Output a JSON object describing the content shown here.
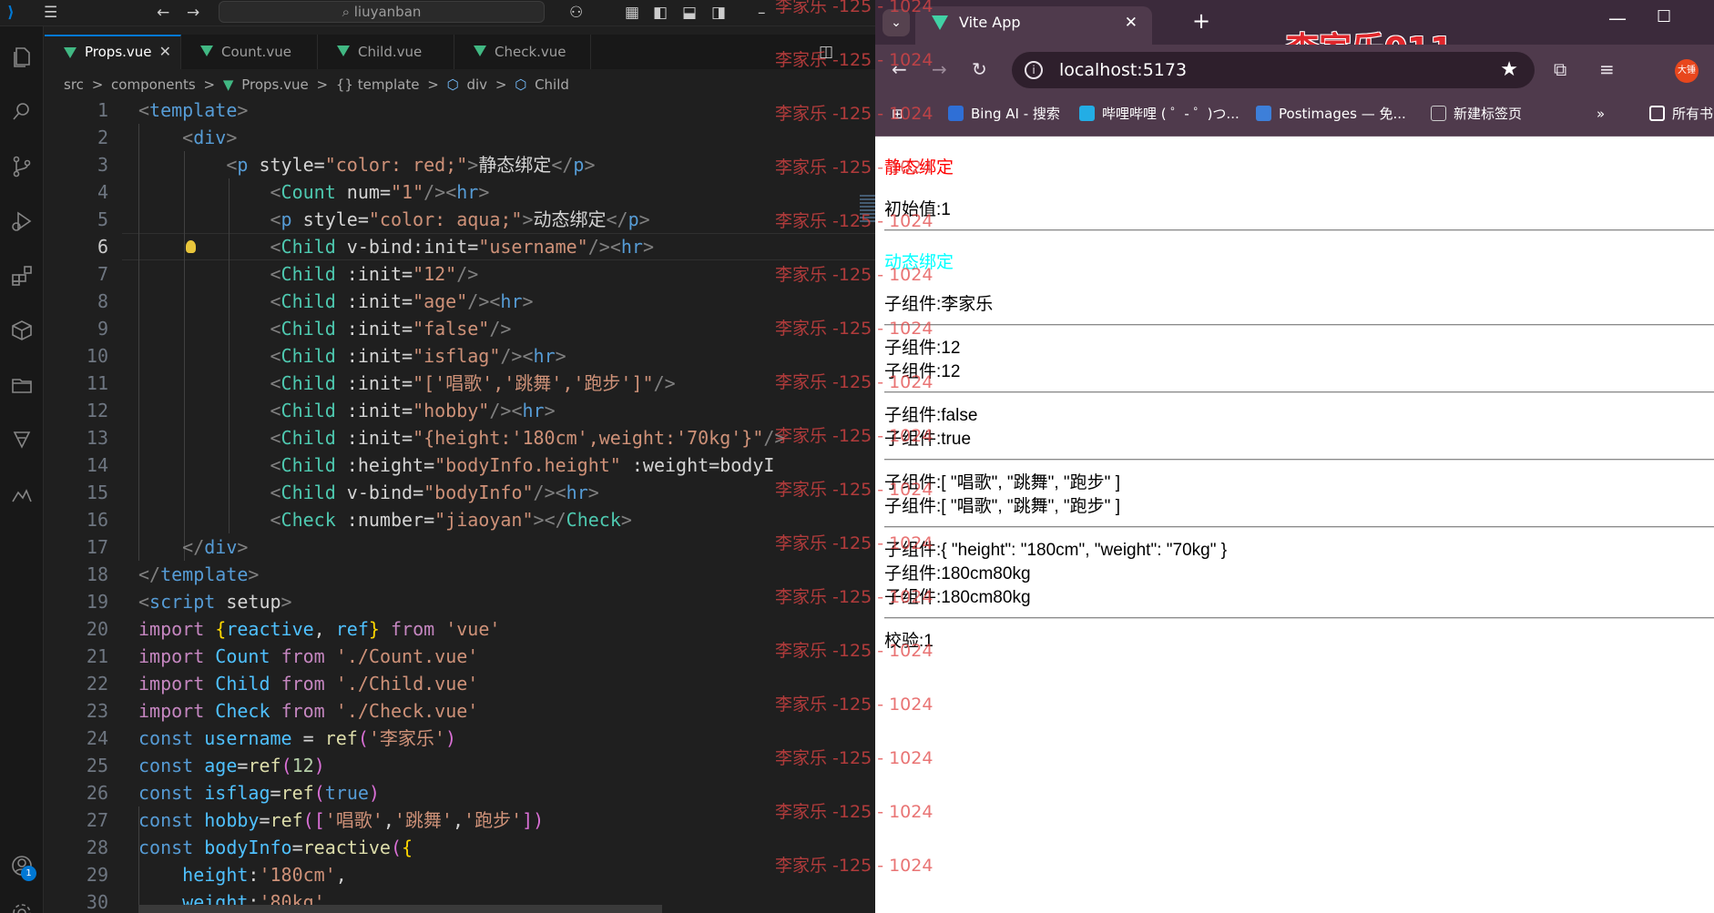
{
  "vscode": {
    "title_search": "liuyanban",
    "tabs": [
      {
        "label": "Props.vue",
        "active": true
      },
      {
        "label": "Count.vue",
        "active": false
      },
      {
        "label": "Child.vue",
        "active": false
      },
      {
        "label": "Check.vue",
        "active": false
      }
    ],
    "breadcrumb": [
      "src",
      ">",
      "components",
      ">",
      "Props.vue",
      ">",
      "{} template",
      ">",
      "div",
      ">",
      "Child"
    ],
    "badge_count": "1",
    "current_line": 6,
    "line_numbers": [
      "1",
      "2",
      "3",
      "4",
      "5",
      "6",
      "7",
      "8",
      "9",
      "10",
      "11",
      "12",
      "13",
      "14",
      "15",
      "16",
      "17",
      "18",
      "19",
      "20",
      "21",
      "22",
      "23",
      "24",
      "25",
      "26",
      "27",
      "28",
      "29",
      "30"
    ],
    "code_lines": [
      "<template>",
      "    <div>",
      "        <p style=\"color: red;\">静态绑定</p>",
      "            <Count num=\"1\"/><hr>",
      "            <p style=\"color: aqua;\">动态绑定</p>",
      "            <Child v-bind:init=\"username\"/><hr>",
      "            <Child :init=\"12\"/>",
      "            <Child :init=\"age\"/><hr>",
      "            <Child :init=\"false\"/>",
      "            <Child :init=\"isflag\"/><hr>",
      "            <Child :init=\"['唱歌','跳舞','跑步']\"/>",
      "            <Child :init=\"hobby\"/><hr>",
      "            <Child :init=\"{height:'180cm',weight:'70kg'}\"/>",
      "            <Child :height=\"bodyInfo.height\" :weight=\"bodyI",
      "            <Child v-bind=\"bodyInfo\"/><hr>",
      "            <Check :number=\"jiaoyan\"></Check>",
      "    </div>",
      "</template>",
      "<script setup>",
      "import {reactive, ref} from 'vue'",
      "import Count from './Count.vue'",
      "import Child from './Child.vue'",
      "import Check from './Check.vue'",
      "const username = ref('李家乐')",
      "const age=ref(12)",
      "const isflag=ref(true)",
      "const hobby=ref(['唱歌','跳舞','跑步'])",
      "const bodyInfo=reactive({",
      "    height:'180cm',",
      "    weight:'80kg'"
    ]
  },
  "browser": {
    "tab_title": "Vite App",
    "url": "localhost:5173",
    "overlay_text": "李家乐011",
    "avatar_text": "大锤",
    "bookmarks": [
      "Bing AI - 搜索",
      "哔哩哔哩 ( ゜- ゜)つ...",
      "Postimages — 免...",
      "新建标签页",
      "所有书"
    ],
    "content": {
      "static_title": "静态绑定",
      "initial_value": "初始值:1",
      "dynamic_title": "动态绑定",
      "lines": [
        "子组件:李家乐",
        "子组件:12",
        "子组件:12",
        "子组件:false",
        "子组件:true",
        "子组件:[ \"唱歌\", \"跳舞\", \"跑步\" ]",
        "子组件:[ \"唱歌\", \"跳舞\", \"跑步\" ]",
        "子组件:{ \"height\": \"180cm\", \"weight\": \"70kg\" }",
        "子组件:180cm80kg",
        "子组件:180cm80kg",
        "校验:1"
      ]
    }
  },
  "watermark": {
    "text": "李家乐 -125 - 1024",
    "color": "#e24646"
  },
  "colors": {
    "vue_green": "#41b883",
    "accent_blue": "#0078d4",
    "static_red": "#ff0000",
    "dynamic_aqua": "#00ffff"
  }
}
